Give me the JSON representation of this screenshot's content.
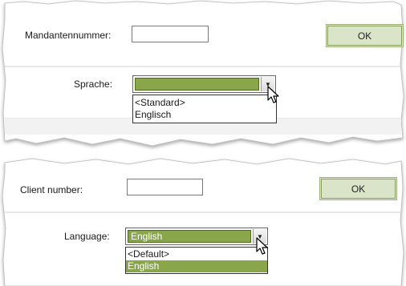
{
  "top_panel": {
    "client_label": "Mandantennummer:",
    "client_value": "",
    "ok_label": "OK",
    "language_label": "Sprache:",
    "language_selected": "",
    "options": [
      "<Standard>",
      "Englisch"
    ]
  },
  "bottom_panel": {
    "client_label": "Client number:",
    "client_value": "",
    "ok_label": "OK",
    "language_label": "Language:",
    "language_selected": "English",
    "options": [
      "<Default>",
      "English"
    ],
    "highlighted_option": "English"
  },
  "colors": {
    "accent_green": "#8aa64a",
    "ok_button_bg": "#d9e4c8",
    "divider": "#c8c8c8"
  },
  "icons": [
    "dropdown-arrow-icon",
    "mouse-pointer-icon"
  ]
}
